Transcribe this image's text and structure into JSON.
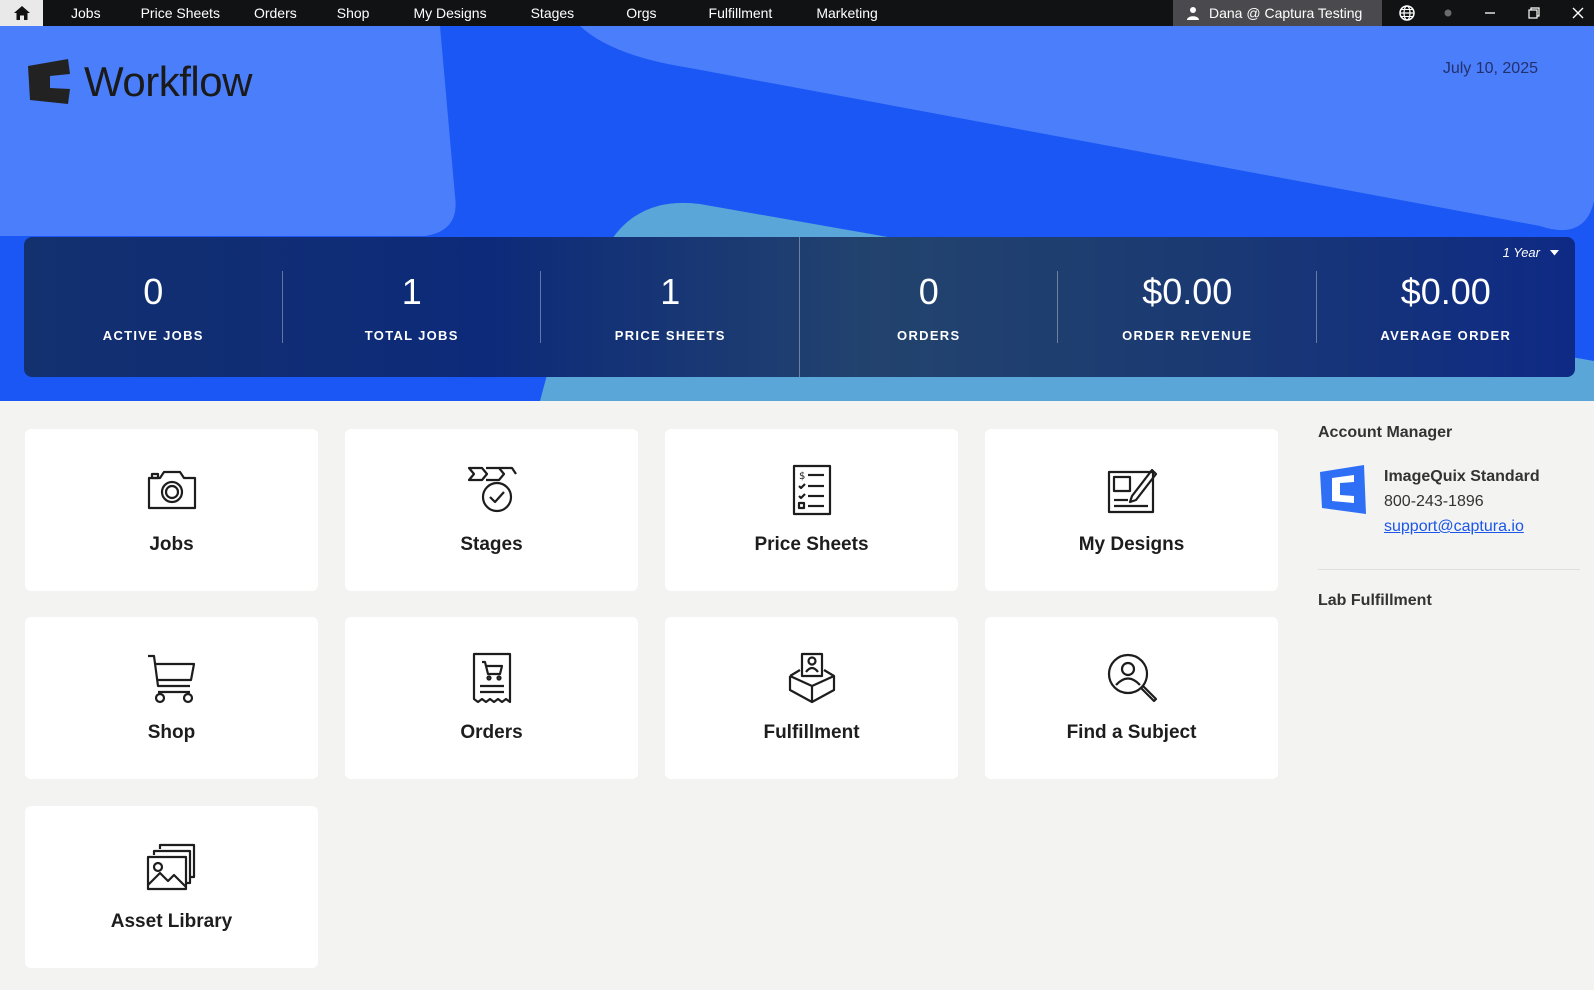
{
  "topbar": {
    "nav": [
      "Jobs",
      "Price Sheets",
      "Orders",
      "Shop",
      "My Designs",
      "Stages",
      "Orgs",
      "Fulfillment",
      "Marketing"
    ],
    "user": "Dana @ Captura Testing"
  },
  "hero": {
    "logo_text": "Workflow",
    "date": "July 10, 2025",
    "range": "1 Year",
    "stats": [
      {
        "value": "0",
        "label": "ACTIVE JOBS"
      },
      {
        "value": "1",
        "label": "TOTAL JOBS"
      },
      {
        "value": "1",
        "label": "PRICE SHEETS"
      },
      {
        "value": "0",
        "label": "ORDERS"
      },
      {
        "value": "$0.00",
        "label": "ORDER REVENUE"
      },
      {
        "value": "$0.00",
        "label": "AVERAGE ORDER"
      }
    ]
  },
  "tiles": [
    {
      "label": "Jobs",
      "icon": "camera-icon"
    },
    {
      "label": "Stages",
      "icon": "stages-check-icon"
    },
    {
      "label": "Price Sheets",
      "icon": "price-list-icon"
    },
    {
      "label": "My Designs",
      "icon": "design-edit-icon"
    },
    {
      "label": "Shop",
      "icon": "cart-icon"
    },
    {
      "label": "Orders",
      "icon": "receipt-cart-icon"
    },
    {
      "label": "Fulfillment",
      "icon": "box-person-icon"
    },
    {
      "label": "Find a Subject",
      "icon": "person-search-icon"
    },
    {
      "label": "Asset Library",
      "icon": "images-icon"
    }
  ],
  "account_manager": {
    "heading": "Account Manager",
    "plan": "ImageQuix Standard",
    "phone": "800-243-1896",
    "email": "support@captura.io"
  },
  "lab_fulfillment": {
    "heading": "Lab Fulfillment"
  },
  "colors": {
    "hero_blue": "#1a57f5",
    "stats_navy": "#13306f",
    "link": "#1b56e8"
  }
}
